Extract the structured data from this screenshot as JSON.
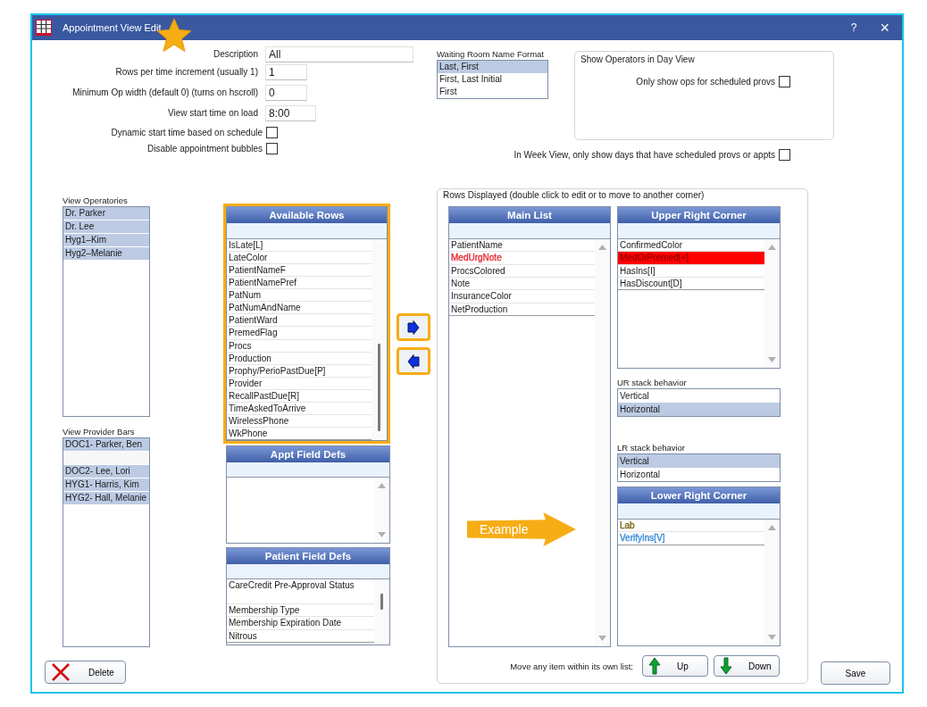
{
  "window": {
    "title": "Appointment View Edit",
    "help_button": "?",
    "close_button": "×"
  },
  "form": {
    "fields": [
      {
        "label": "Description",
        "value": "All",
        "kind": "wide"
      },
      {
        "label": "Rows per time increment (usually 1)",
        "value": "1",
        "kind": "short"
      },
      {
        "label": "Minimum Op width (default 0) (turns on hscroll)",
        "value": "0",
        "kind": "short"
      },
      {
        "label": "View start time on load",
        "value": "8:00",
        "kind": "medium"
      }
    ],
    "checkboxes": [
      {
        "label": "Dynamic start time based on schedule",
        "checked": false
      },
      {
        "label": "Disable appointment bubbles",
        "checked": false
      }
    ]
  },
  "waiting_room": {
    "label": "Waiting Room Name Format",
    "options": [
      {
        "label": "Last, First",
        "selected": true
      },
      {
        "label": "First, Last Initial",
        "selected": false
      },
      {
        "label": "First",
        "selected": false
      }
    ]
  },
  "show_operators": {
    "title": "Show Operators in Day View",
    "checkbox": {
      "label": "Only show ops for scheduled provs",
      "checked": false
    }
  },
  "week_view_checkbox": {
    "label": "In Week View, only show days that have scheduled provs or appts",
    "checked": false
  },
  "view_operatories": {
    "label": "View Operatories",
    "items": [
      {
        "label": "Dr. Parker",
        "selected": true
      },
      {
        "label": "Dr. Lee",
        "selected": true
      },
      {
        "label": "Hyg1–Kim",
        "selected": true
      },
      {
        "label": "Hyg2–Melanie",
        "selected": true
      }
    ]
  },
  "view_provider_bars": {
    "label": "View Provider Bars",
    "items": [
      {
        "label": "DOC1- Parker, Ben",
        "selected": true
      },
      {
        "selected": false
      },
      {
        "label": "DOC2- Lee, Lori",
        "selected": true
      },
      {
        "label": "HYG1- Harris, Kim",
        "selected": true
      },
      {
        "label": "HYG2- Hall, Melanie",
        "selected": true
      }
    ]
  },
  "available_rows": {
    "title": "Available Rows",
    "highlighted": true,
    "items": [
      {
        "label": "IsLate[L]",
        "selected": false
      },
      {
        "label": "LateColor",
        "selected": false
      },
      {
        "label": "PatientNameF",
        "selected": false
      },
      {
        "label": "PatientNamePref",
        "selected": false
      },
      {
        "label": "PatNum",
        "selected": false
      },
      {
        "label": "PatNumAndName",
        "selected": false
      },
      {
        "label": "PatientWard",
        "selected": false
      },
      {
        "label": "PremedFlag",
        "selected": false
      },
      {
        "label": "Procs",
        "selected": false
      },
      {
        "label": "Production",
        "selected": false
      },
      {
        "label": "Prophy/PerioPastDue[P]",
        "selected": false
      },
      {
        "label": "Provider",
        "selected": false
      },
      {
        "label": "RecallPastDue[R]",
        "selected": false
      },
      {
        "label": "TimeAskedToArrive",
        "selected": false
      },
      {
        "label": "WirelessPhone",
        "selected": false
      },
      {
        "label": "WkPhone",
        "selected": false
      }
    ]
  },
  "move_buttons": [
    {
      "kind": "right",
      "highlighted": true
    },
    {
      "kind": "left",
      "highlighted": true
    }
  ],
  "appt_field_defs": {
    "title": "Appt Field Defs"
  },
  "patient_field_defs": {
    "title": "Patient Field Defs",
    "items": [
      {
        "label": "CareCredit Pre-Approval Status",
        "selected": false
      },
      {
        "label": "Membership Type",
        "selected": false
      },
      {
        "label": "Membership Expiration Date",
        "selected": false
      },
      {
        "label": "Nitrous",
        "selected": false
      }
    ]
  },
  "rows_displayed": {
    "title": "Rows Displayed (double click to edit or to move to another corner)",
    "main_list": {
      "title": "Main List",
      "items": [
        {
          "label": "PatientName",
          "selected": false
        },
        {
          "label": "MedUrgNote",
          "selected": false,
          "kind": "text",
          "color": "#e8323c"
        },
        {
          "label": "ProcsColored",
          "selected": false
        },
        {
          "label": "Note",
          "selected": false
        },
        {
          "label": "InsuranceColor",
          "selected": false
        },
        {
          "label": "NetProduction",
          "selected": false
        }
      ]
    },
    "upper_right": {
      "title": "Upper Right Corner",
      "items": [
        {
          "label": "ConfirmedColor",
          "selected": false
        },
        {
          "label": "MedOrPremed[+]",
          "selected": false,
          "kind": "fill",
          "color": "#ff0000"
        },
        {
          "label": "HasIns[I]",
          "selected": false
        },
        {
          "label": "HasDiscount[D]",
          "selected": false
        }
      ]
    },
    "ur_stack": {
      "label": "UR stack behavior",
      "options": [
        {
          "label": "Vertical",
          "selected": false
        },
        {
          "label": "Horizontal",
          "selected": true
        }
      ]
    },
    "lr_stack": {
      "label": "LR stack behavior",
      "options": [
        {
          "label": "Vertical",
          "selected": true
        },
        {
          "label": "Horizontal",
          "selected": false
        }
      ]
    },
    "lower_right": {
      "title": "Lower Right Corner",
      "items": [
        {
          "label": "Lab",
          "selected": false,
          "kind": "text",
          "color": "#7a6a1e"
        },
        {
          "label": "VerifyIns[V]",
          "selected": false,
          "kind": "text",
          "color": "#3d8fd8"
        }
      ]
    },
    "example_callout": "Example",
    "move_label": "Move any item within its own list:",
    "up_button": "Up",
    "down_button": "Down"
  },
  "delete_button": "Delete",
  "save_button": "Save"
}
